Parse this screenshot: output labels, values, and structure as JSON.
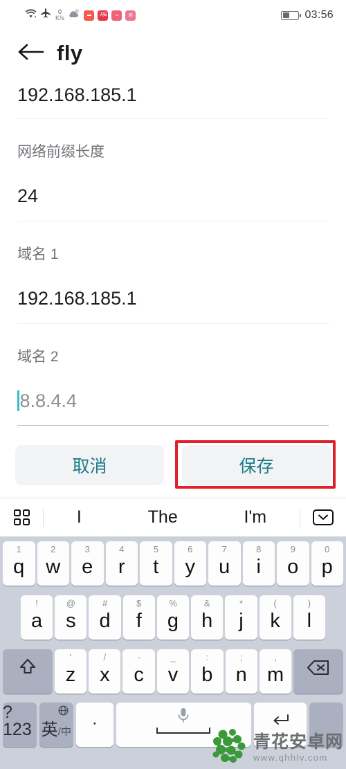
{
  "status_bar": {
    "network_speed_value": "0",
    "network_speed_unit": "K/s",
    "time": "03:56",
    "icons": [
      "wifi-icon",
      "airplane-mode-icon",
      "weather-icon",
      "app-badge-1",
      "app-badge-2",
      "app-badge-3",
      "app-badge-4",
      "battery-icon"
    ],
    "battery_percent": 38
  },
  "app_bar": {
    "back_label": "back-arrow",
    "title": "fly"
  },
  "form": {
    "fields": [
      {
        "label": "",
        "value": "192.168.185.1",
        "is_placeholder": false,
        "active": false
      },
      {
        "label": "网络前缀长度",
        "value": "24",
        "is_placeholder": false,
        "active": false
      },
      {
        "label": "域名 1",
        "value": "192.168.185.1",
        "is_placeholder": false,
        "active": false
      },
      {
        "label": "域名 2",
        "value": "8.8.4.4",
        "is_placeholder": true,
        "active": true
      }
    ]
  },
  "actions": {
    "cancel_label": "取消",
    "save_label": "保存",
    "highlight_color": "#e0202a",
    "button_text_color": "#1b7a87"
  },
  "keyboard": {
    "suggestions": [
      "I",
      "The",
      "I'm"
    ],
    "toolbar_left_icon": "grid-menu-icon",
    "toolbar_right_icon": "hide-keyboard-icon",
    "row1": [
      {
        "main": "q",
        "sub": "1"
      },
      {
        "main": "w",
        "sub": "2"
      },
      {
        "main": "e",
        "sub": "3"
      },
      {
        "main": "r",
        "sub": "4"
      },
      {
        "main": "t",
        "sub": "5"
      },
      {
        "main": "y",
        "sub": "6"
      },
      {
        "main": "u",
        "sub": "7"
      },
      {
        "main": "i",
        "sub": "8"
      },
      {
        "main": "o",
        "sub": "9"
      },
      {
        "main": "p",
        "sub": "0"
      }
    ],
    "row2": [
      {
        "main": "a",
        "sub": "!"
      },
      {
        "main": "s",
        "sub": "@"
      },
      {
        "main": "d",
        "sub": "#"
      },
      {
        "main": "f",
        "sub": "$"
      },
      {
        "main": "g",
        "sub": "%"
      },
      {
        "main": "h",
        "sub": "&"
      },
      {
        "main": "j",
        "sub": "*"
      },
      {
        "main": "k",
        "sub": "("
      },
      {
        "main": "l",
        "sub": ")"
      }
    ],
    "row3": [
      {
        "main": "z",
        "sub": "'"
      },
      {
        "main": "x",
        "sub": "/"
      },
      {
        "main": "c",
        "sub": "-"
      },
      {
        "main": "v",
        "sub": "_"
      },
      {
        "main": "b",
        "sub": ":"
      },
      {
        "main": "n",
        "sub": ";"
      },
      {
        "main": "m",
        "sub": ","
      }
    ],
    "shift_key": "shift-icon",
    "backspace_key": "backspace-icon",
    "row4": {
      "symbols_label": "?123",
      "lang_label_primary": "英",
      "lang_label_secondary": "/中",
      "lang_globe_icon": "globe-icon",
      "period_label": "·",
      "space_icon": "microphone-icon",
      "return_icon": "enter-icon"
    }
  },
  "watermark": {
    "site_name": "青花安卓网",
    "site_url": "www.qhhlv.com",
    "logo": "cluster-logo-icon"
  }
}
